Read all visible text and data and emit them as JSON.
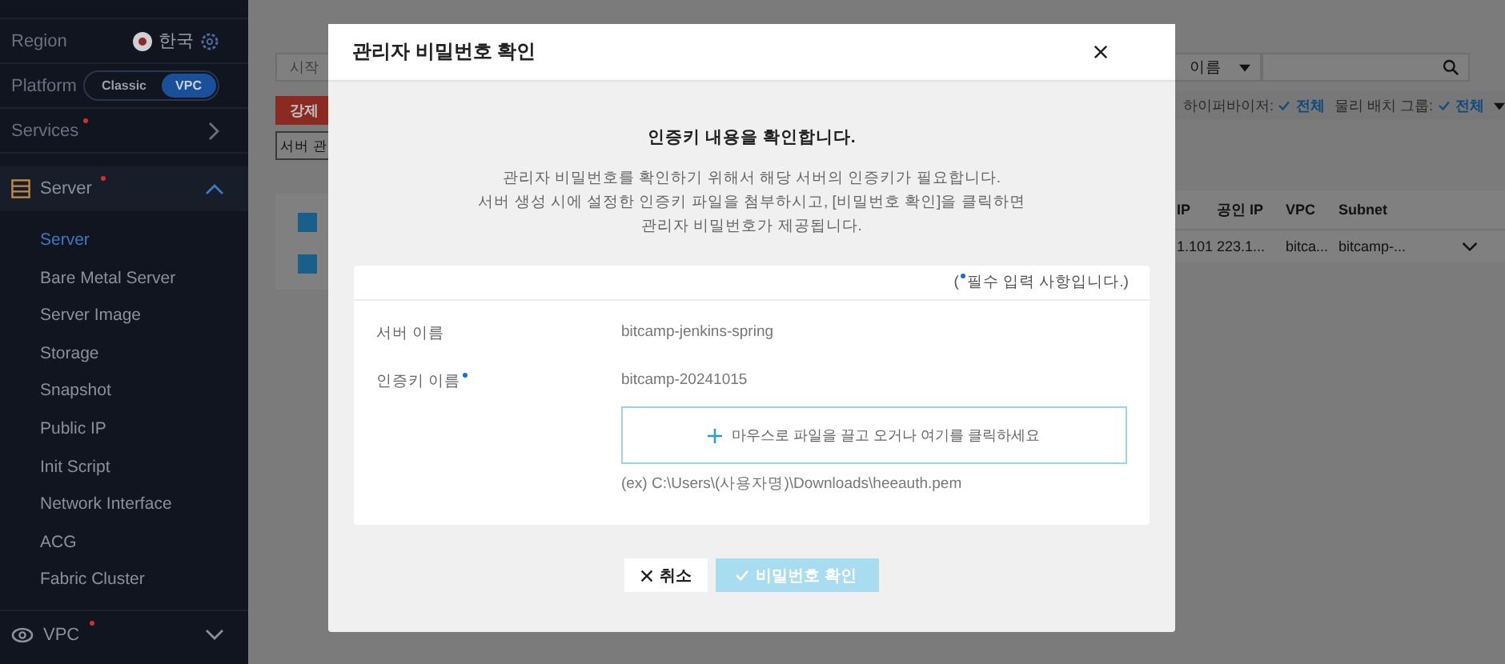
{
  "sidebar": {
    "region": {
      "label": "Region",
      "value": "한국"
    },
    "platform": {
      "label": "Platform",
      "options": [
        {
          "label": "Classic",
          "selected": false
        },
        {
          "label": "VPC",
          "selected": true
        }
      ]
    },
    "services": {
      "label": "Services",
      "badge": true
    },
    "server_section": {
      "label": "Server",
      "badge": true,
      "expanded": true,
      "items": [
        {
          "label": "Server",
          "selected": true
        },
        {
          "label": "Bare Metal Server",
          "selected": false
        },
        {
          "label": "Server Image",
          "selected": false
        },
        {
          "label": "Storage",
          "selected": false
        },
        {
          "label": "Snapshot",
          "selected": false
        },
        {
          "label": "Public IP",
          "selected": false
        },
        {
          "label": "Init Script",
          "selected": false
        },
        {
          "label": "Network Interface",
          "selected": false
        },
        {
          "label": "ACG",
          "selected": false
        },
        {
          "label": "Fabric Cluster",
          "selected": false
        }
      ]
    },
    "vpc_section": {
      "label": "VPC",
      "badge": true,
      "expanded": false
    }
  },
  "background": {
    "left": {
      "search_placeholder": "시작",
      "danger_button": "강제",
      "manage_button": "서버 관",
      "header_checked": true,
      "row_checked": true
    },
    "right": {
      "search_type": "이름",
      "filters": [
        {
          "label": "하이퍼바이저:",
          "value": "전체"
        },
        {
          "label": "물리 배치 그룹:",
          "value": "전체"
        }
      ],
      "columns": [
        "IP",
        "공인 IP",
        "VPC",
        "Subnet"
      ],
      "row": [
        "1.101",
        "223.1...",
        "bitca...",
        "bitcamp-..."
      ]
    }
  },
  "dialog": {
    "title": "관리자 비밀번호 확인",
    "heading": "인증키 내용을 확인합니다.",
    "description": [
      "관리자 비밀번호를 확인하기 위해서 해당 서버의 인증키가 필요합니다.",
      "서버 생성 시에 설정한 인증키 파일을 첨부하시고, [비밀번호 확인]을 클릭하면",
      "관리자 비밀번호가 제공됩니다."
    ],
    "required_note": {
      "open": "(",
      "text": "필수 입력 사항입니다.)"
    },
    "fields": [
      {
        "label": "서버 이름",
        "required": false,
        "value": "bitcamp-jenkins-spring"
      },
      {
        "label": "인증키 이름",
        "required": true,
        "value": "bitcamp-20241015"
      }
    ],
    "dropzone": "마우스로 파일을 끌고 오거나 여기를 클릭하세요",
    "hint": "(ex) C:\\Users\\(사용자명)\\Downloads\\heeauth.pem",
    "buttons": [
      {
        "kind": "cancel",
        "label": "취소",
        "disabled": false
      },
      {
        "kind": "confirm",
        "label": "비밀번호 확인",
        "disabled": true
      }
    ]
  }
}
